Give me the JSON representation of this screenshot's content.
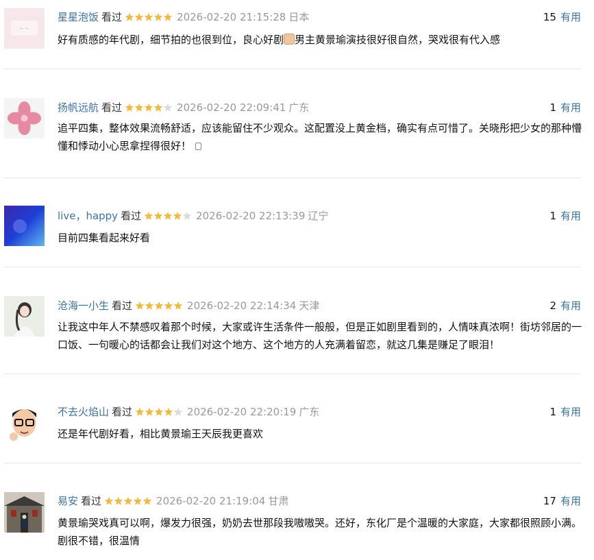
{
  "colors": {
    "username": "#3a73a8",
    "star_filled": "#f5b93a",
    "star_empty": "#dcdcdc",
    "meta_gray": "#999999",
    "vote_link": "#3a73a8"
  },
  "comments": [
    {
      "user": "星星泡饭",
      "status": "看过",
      "rating": 5,
      "time": "2026-02-20 21:15:28",
      "location": "日本",
      "votes": "15",
      "vote_label": "有用",
      "text_before": "好有质感的年代剧，细节拍的也很到位，良心好剧",
      "emoji": "thumbs-up-emoji",
      "text_after": "男主黄景瑜演技很好很自然，哭戏很有代入感"
    },
    {
      "user": "扬帆远航",
      "status": "看过",
      "rating": 4,
      "time": "2026-02-20 22:09:41",
      "location": "广东",
      "votes": "1",
      "vote_label": "有用",
      "text": "追平四集，整体效果流畅舒适，应该能留住不少观众。这配置没上黄金档，确实有点可惜了。关晓彤把少女的那种懵懂和悸动小心思拿捏得很好！"
    },
    {
      "user": "live，happy",
      "status": "看过",
      "rating": 4,
      "time": "2026-02-20 22:13:39",
      "location": "辽宁",
      "votes": "1",
      "vote_label": "有用",
      "text": "目前四集看起来好看"
    },
    {
      "user": "沧海一小生",
      "status": "看过",
      "rating": 5,
      "time": "2026-02-20 22:14:34",
      "location": "天津",
      "votes": "2",
      "vote_label": "有用",
      "text": "让我这中年人不禁感叹着那个时候，大家或许生活条件一般般，但是正如剧里看到的，人情味真浓啊！街坊邻居的一口饭、一句暖心的话都会让我们对这个地方、这个地方的人充满着留恋，就这几集是赚足了眼泪！"
    },
    {
      "user": "不去火焰山",
      "status": "看过",
      "rating": 4,
      "time": "2026-02-20 22:20:19",
      "location": "广东",
      "votes": "1",
      "vote_label": "有用",
      "text": "还是年代剧好看，相比黄景瑜王天辰我更喜欢"
    },
    {
      "user": "易安",
      "status": "看过",
      "rating": 5,
      "time": "2026-02-20 21:19:04",
      "location": "甘肃",
      "votes": "17",
      "vote_label": "有用",
      "text": "黄景瑜哭戏真可以啊，爆发力很强，奶奶去世那段我嗷嗷哭。还好，东化厂是个温暖的大家庭，大家都很照顾小满。剧很不错，很温情"
    }
  ]
}
